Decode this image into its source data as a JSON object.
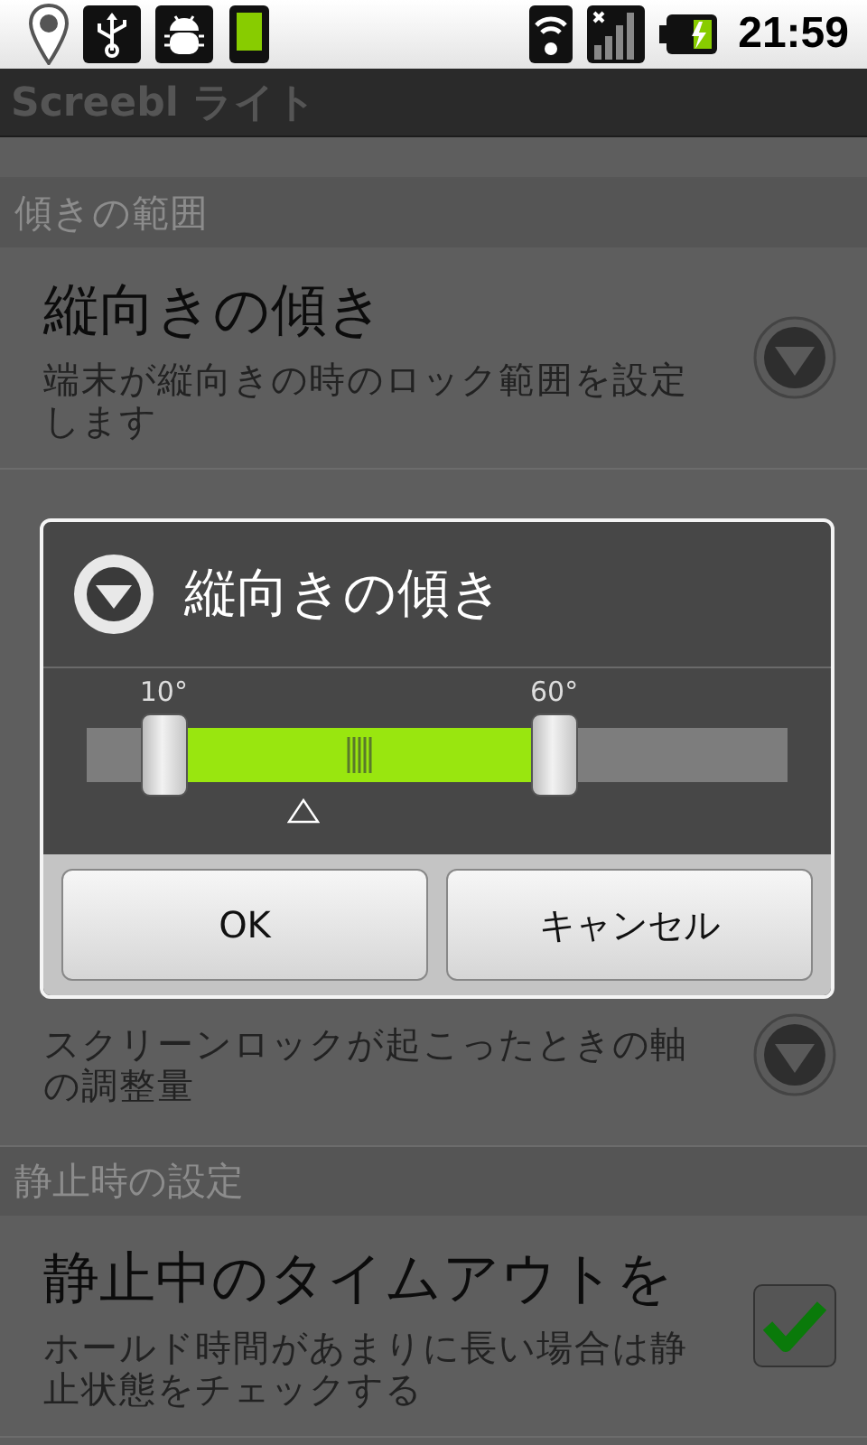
{
  "status_bar": {
    "time": "21:59"
  },
  "app_bar": {
    "title": "Screebl ライト"
  },
  "preferences": [
    {
      "kind": "category",
      "title": "傾きの範囲"
    },
    {
      "kind": "dropdown",
      "title": "縦向きの傾き",
      "summary": "端末が縦向きの時のロック範囲を設定します"
    },
    {
      "kind": "dropdown",
      "summary": "スクリーンロックが起こったときの軸の調整量"
    },
    {
      "kind": "category",
      "title": "静止時の設定"
    },
    {
      "kind": "checkbox",
      "title": "静止中のタイムアウトを",
      "summary": "ホールド時間があまりに長い場合は静止状態をチェックする",
      "checked": true
    }
  ],
  "dialog": {
    "title": "縦向きの傾き",
    "slider": {
      "thumbs": [
        {
          "label": "10°",
          "level": 0.11
        },
        {
          "label": "60°",
          "level": 0.667
        }
      ],
      "marker": {
        "level": 0.31
      }
    },
    "buttons": [
      "OK",
      "キャンセル"
    ]
  }
}
